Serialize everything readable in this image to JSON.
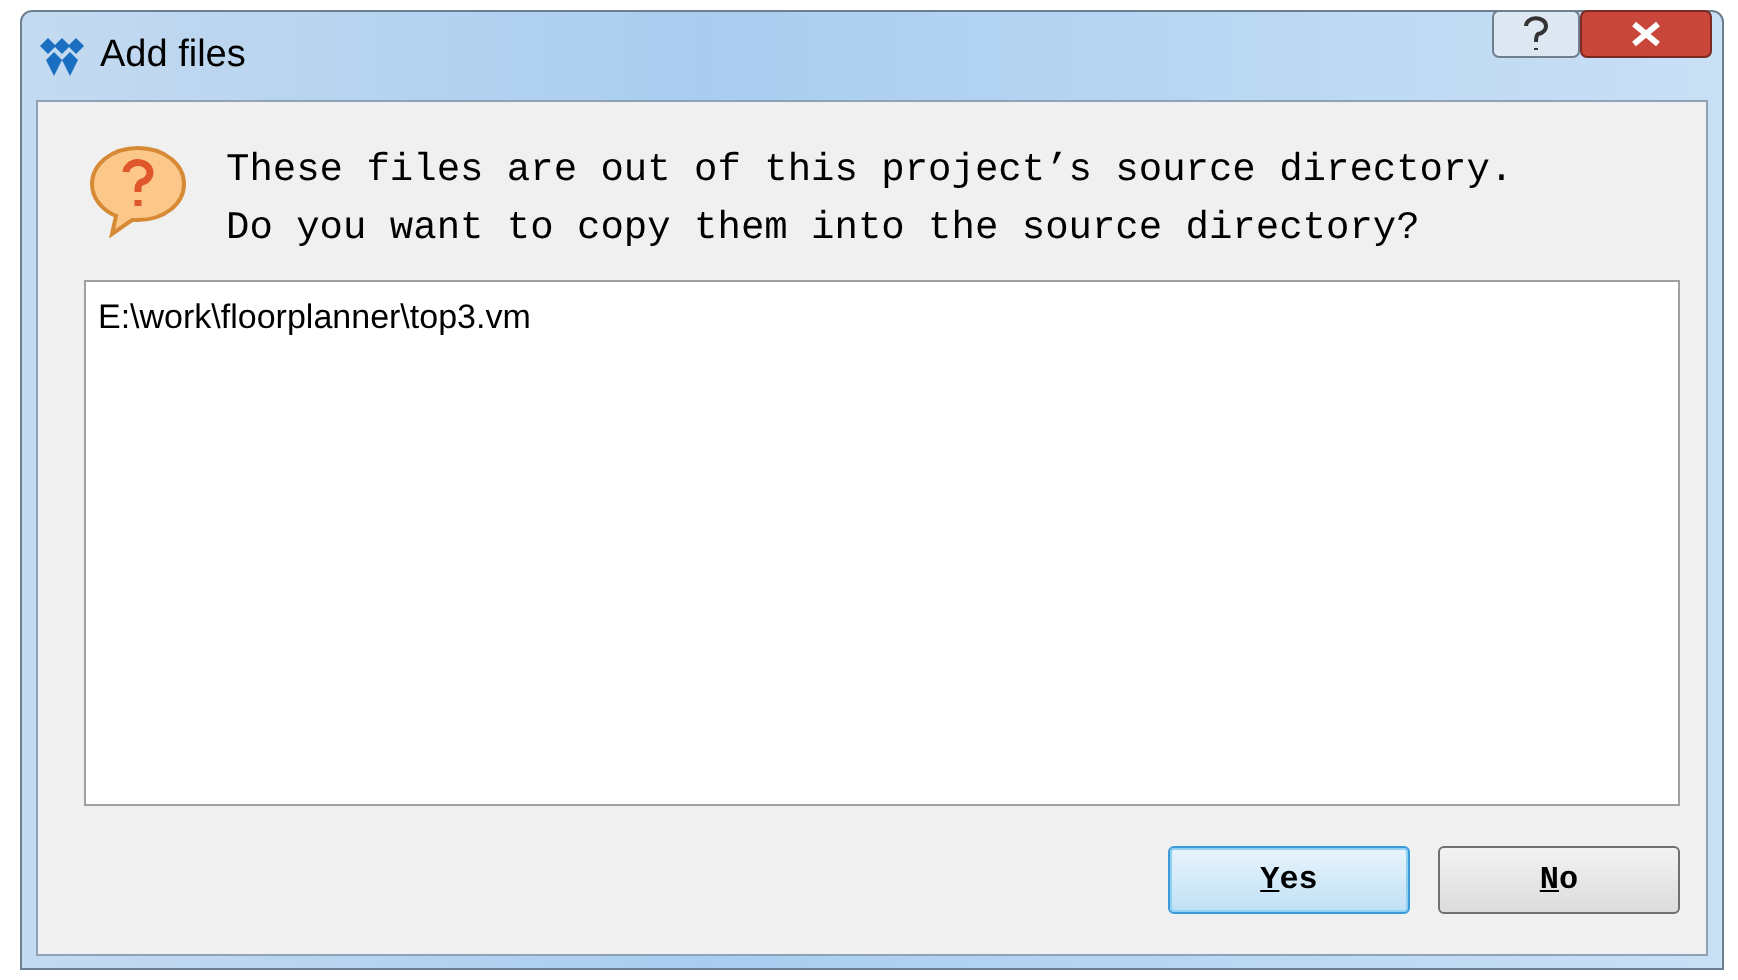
{
  "window": {
    "title": "Add files"
  },
  "message": {
    "lines": [
      "These files are out of this project’s source directory.",
      "Do you want to copy them into the source directory?"
    ]
  },
  "file_list": {
    "items": [
      "E:\\work\\floorplanner\\top3.vm"
    ]
  },
  "buttons": [
    {
      "label": "Yes",
      "default": true
    },
    {
      "label": "No",
      "default": false
    }
  ]
}
